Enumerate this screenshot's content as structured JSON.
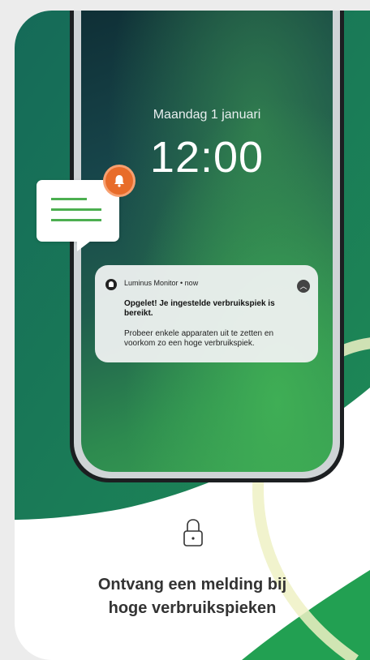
{
  "lockscreen": {
    "date": "Maandag 1 januari",
    "time": "12:00"
  },
  "notification": {
    "app": "Luminus Monitor • now",
    "title": "Opgelet! Je ingestelde verbruikspiek is bereikt.",
    "body": "Probeer enkele apparaten uit te zetten en voorkom zo een hoge verbruikspiek.",
    "expand_icon": "chevron-up-icon"
  },
  "decorations": {
    "message_icon": "chat-bubble-icon",
    "badge_icon": "bell-icon",
    "lock_icon": "lock-icon"
  },
  "feature": {
    "headline_line1": "Ontvang een melding bij",
    "headline_line2": "hoge verbruikspieken"
  },
  "colors": {
    "brand_dark": "#17784f",
    "brand_green": "#3aa052",
    "accent_orange": "#e86c2a",
    "highlight_yellow": "#eef1c4"
  }
}
